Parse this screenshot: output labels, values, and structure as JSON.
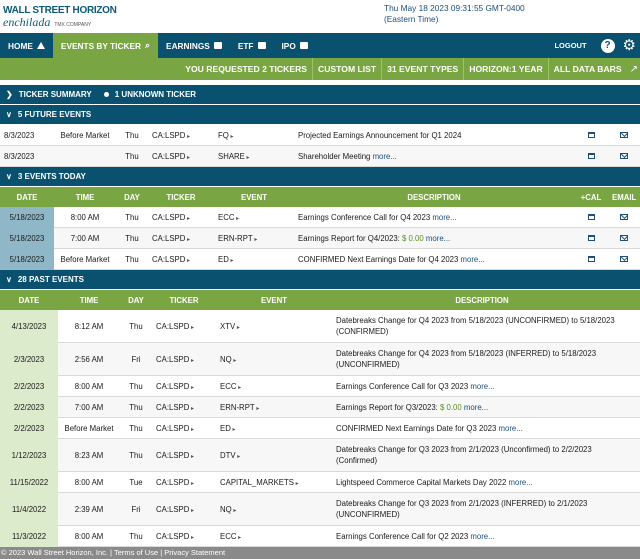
{
  "brand": {
    "line1": "WALL STREET HORIZON",
    "line2": "enchilada",
    "tmx": "TMX COMPANY"
  },
  "datetime": {
    "line1": "Thu May 18 2023 09:31:55 GMT-0400",
    "line2": "(Eastern Time)"
  },
  "nav": {
    "items": [
      {
        "label": "HOME",
        "icon": "home-icon"
      },
      {
        "label": "EVENTS BY TICKER",
        "icon": "search-icon"
      },
      {
        "label": "EARNINGS",
        "icon": "calendar-icon"
      },
      {
        "label": "ETF",
        "icon": "calendar-icon"
      },
      {
        "label": "IPO",
        "icon": "calendar-icon"
      }
    ],
    "logout": "LOGOUT",
    "help": "?",
    "gear": "⚙"
  },
  "filters": [
    "YOU REQUESTED 2 TICKERS",
    "CUSTOM LIST",
    "31 EVENT TYPES",
    "HORIZON:1 YEAR",
    "ALL DATA BARS"
  ],
  "ticker_summary": {
    "title": "TICKER SUMMARY",
    "unknown": "1 UNKNOWN TICKER"
  },
  "future": {
    "title": "5 FUTURE EVENTS",
    "rows": [
      {
        "date": "8/3/2023",
        "time": "Before Market",
        "day": "Thu",
        "ticker": "CA:LSPD",
        "event": "FQ",
        "desc": "Projected Earnings Announcement for Q1 2024",
        "more": ""
      },
      {
        "date": "8/3/2023",
        "time": "",
        "day": "Thu",
        "ticker": "CA:LSPD",
        "event": "SHARE",
        "desc": "Shareholder Meeting",
        "more": "more..."
      }
    ]
  },
  "today": {
    "title": "3 EVENTS TODAY",
    "columns": [
      "DATE",
      "TIME",
      "DAY",
      "TICKER",
      "EVENT",
      "DESCRIPTION",
      "+CAL",
      "EMAIL"
    ],
    "rows": [
      {
        "date": "5/18/2023",
        "time": "8:00 AM",
        "day": "Thu",
        "ticker": "CA:LSPD",
        "event": "ECC",
        "desc": "Earnings Conference Call for Q4 2023",
        "amount": "",
        "more": "more..."
      },
      {
        "date": "5/18/2023",
        "time": "7:00 AM",
        "day": "Thu",
        "ticker": "CA:LSPD",
        "event": "ERN-RPT",
        "desc": "Earnings Report for Q4/2023:",
        "amount": "$ 0.00",
        "more": "more..."
      },
      {
        "date": "5/18/2023",
        "time": "Before Market",
        "day": "Thu",
        "ticker": "CA:LSPD",
        "event": "ED",
        "desc": "CONFIRMED Next Earnings Date for Q4 2023",
        "amount": "",
        "more": "more..."
      }
    ]
  },
  "past": {
    "title": "28 PAST EVENTS",
    "columns": [
      "DATE",
      "TIME",
      "DAY",
      "TICKER",
      "EVENT",
      "DESCRIPTION"
    ],
    "rows": [
      {
        "date": "4/13/2023",
        "time": "8:12 AM",
        "day": "Thu",
        "ticker": "CA:LSPD",
        "event": "XTV",
        "desc": "Datebreaks Change for Q4 2023 from 5/18/2023 (UNCONFIRMED) to 5/18/2023 (CONFIRMED)",
        "amount": "",
        "more": ""
      },
      {
        "date": "2/3/2023",
        "time": "2:56 AM",
        "day": "Fri",
        "ticker": "CA:LSPD",
        "event": "NQ",
        "desc": "Datebreaks Change for Q4 2023 from 5/18/2023 (INFERRED) to 5/18/2023 (UNCONFIRMED)",
        "amount": "",
        "more": ""
      },
      {
        "date": "2/2/2023",
        "time": "8:00 AM",
        "day": "Thu",
        "ticker": "CA:LSPD",
        "event": "ECC",
        "desc": "Earnings Conference Call for Q3 2023",
        "amount": "",
        "more": "more..."
      },
      {
        "date": "2/2/2023",
        "time": "7:00 AM",
        "day": "Thu",
        "ticker": "CA:LSPD",
        "event": "ERN-RPT",
        "desc": "Earnings Report for Q3/2023:",
        "amount": "$ 0.00",
        "more": "more..."
      },
      {
        "date": "2/2/2023",
        "time": "Before Market",
        "day": "Thu",
        "ticker": "CA:LSPD",
        "event": "ED",
        "desc": "CONFIRMED Next Earnings Date for Q3 2023",
        "amount": "",
        "more": "more..."
      },
      {
        "date": "1/12/2023",
        "time": "8:23 AM",
        "day": "Thu",
        "ticker": "CA:LSPD",
        "event": "DTV",
        "desc": "Datebreaks Change for Q3 2023 from 2/1/2023 (Unconfirmed) to 2/2/2023 (Confirmed)",
        "amount": "",
        "more": ""
      },
      {
        "date": "11/15/2022",
        "time": "8:00 AM",
        "day": "Tue",
        "ticker": "CA:LSPD",
        "event": "CAPITAL_MARKETS",
        "desc": "Lightspeed Commerce Capital Markets Day 2022",
        "amount": "",
        "more": "more..."
      },
      {
        "date": "11/4/2022",
        "time": "2:39 AM",
        "day": "Fri",
        "ticker": "CA:LSPD",
        "event": "NQ",
        "desc": "Datebreaks Change for Q3 2023 from 2/1/2023 (INFERRED) to 2/1/2023 (UNCONFIRMED)",
        "amount": "",
        "more": ""
      },
      {
        "date": "11/3/2022",
        "time": "8:00 AM",
        "day": "Thu",
        "ticker": "CA:LSPD",
        "event": "ECC",
        "desc": "Earnings Conference Call for Q2 2023",
        "amount": "",
        "more": "more..."
      }
    ]
  },
  "footer": "© 2023 Wall Street Horizon, Inc. | Terms of Use | Privacy Statement"
}
